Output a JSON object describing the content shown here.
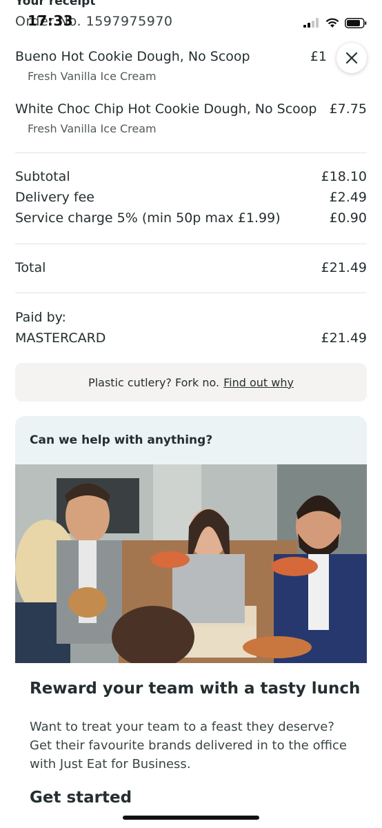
{
  "status_bar": {
    "time": "17:33"
  },
  "header": {
    "title": "Your receipt",
    "order_number": "Order No. 1597975970"
  },
  "close": {
    "label": "Close"
  },
  "items": [
    {
      "name": "Bueno Hot Cookie Dough, No Scoop",
      "price": "£1",
      "option": "Fresh Vanilla Ice Cream"
    },
    {
      "name": "White Choc Chip Hot Cookie Dough, No Scoop",
      "price": "£7.75",
      "option": "Fresh Vanilla Ice Cream"
    }
  ],
  "charges": [
    {
      "label": "Subtotal",
      "amount": "£18.10"
    },
    {
      "label": "Delivery fee",
      "amount": "£2.49"
    },
    {
      "label": "Service charge 5% (min 50p max £1.99)",
      "amount": "£0.90"
    }
  ],
  "total": {
    "label": "Total",
    "amount": "£21.49"
  },
  "payment": {
    "label": "Paid by:",
    "method": "MASTERCARD",
    "amount": "£21.49"
  },
  "cutlery_banner": {
    "text": "Plastic cutlery? Fork no.",
    "link": "Find out why"
  },
  "help": {
    "title": "Can we help with anything?"
  },
  "promo": {
    "title": "Reward your team with a tasty lunch",
    "body": "Want to treat your team to a feast they deserve? Get their favourite brands delivered in to the office with Just Eat for Business.",
    "cta": "Get started"
  },
  "colors": {
    "text": "#242e30",
    "muted": "#535a5c",
    "help_bg": "#ebf3f5",
    "banner_bg": "#f5f3f1"
  }
}
